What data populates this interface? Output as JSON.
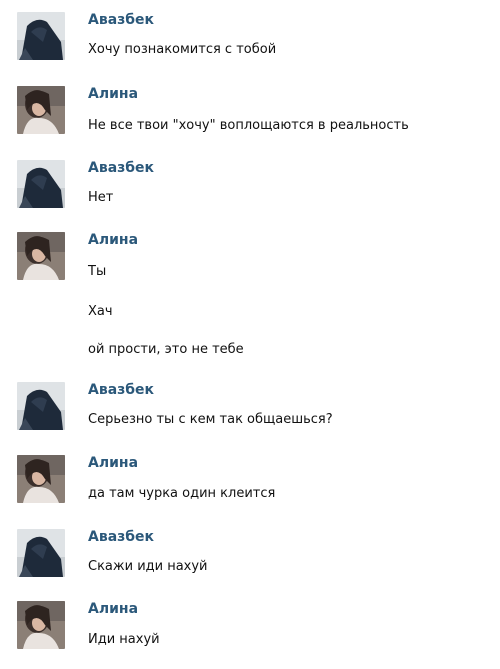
{
  "colors": {
    "author_name": "#2B587A",
    "message_text": "#111111",
    "background": "#FFFFFF"
  },
  "participants": {
    "avazbek": {
      "name": "Авазбек",
      "avatar_icon": "dark-figure-avatar"
    },
    "alina": {
      "name": "Алина",
      "avatar_icon": "girl-photo-avatar"
    }
  },
  "messages": [
    {
      "author": "Авазбек",
      "lines": [
        "Хочу познакомится с тобой"
      ]
    },
    {
      "author": "Алина",
      "lines": [
        "Не все твои \"хочу\" воплощаются в реальность"
      ]
    },
    {
      "author": "Авазбек",
      "lines": [
        "Нет"
      ]
    },
    {
      "author": "Алина",
      "lines": [
        "Ты",
        "Хач",
        "ой прости, это не тебе"
      ]
    },
    {
      "author": "Авазбек",
      "lines": [
        "Серьезно ты с кем так общаешься?"
      ]
    },
    {
      "author": "Алина",
      "lines": [
        "да там чурка один клеится"
      ]
    },
    {
      "author": "Авазбек",
      "lines": [
        "Скажи иди нахуй"
      ]
    },
    {
      "author": "Алина",
      "lines": [
        "Иди нахуй"
      ]
    }
  ]
}
